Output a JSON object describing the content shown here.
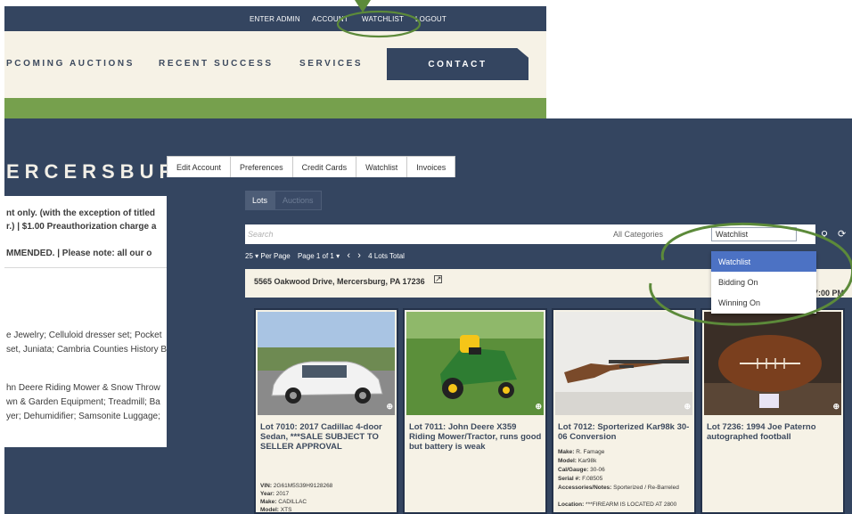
{
  "top_nav": {
    "enter_admin": "ENTER ADMIN",
    "account": "ACCOUNT",
    "watchlist": "WATCHLIST",
    "logout": "LOGOUT"
  },
  "main_nav": {
    "upcoming": "PCOMING AUCTIONS",
    "recent": "RECENT SUCCESS",
    "services": "SERVICES",
    "contact": "CONTACT"
  },
  "hero_title": "ERCERSBUR",
  "notice": {
    "line1": "nt only. (with the exception of titled",
    "line2": "r.) | $1.00 Preauthorization charge a",
    "line3": "MMENDED.  |  Please note:  all our o",
    "line4": "e Jewelry; Celluloid dresser set; Pocket",
    "line5": "set, Juniata; Cambria Counties History B",
    "line6": "hn Deere Riding Mower & Snow Throw",
    "line7": "wn & Garden Equipment; Treadmill; Ba",
    "line8": "yer; Dehumidifier; Samsonite Luggage;"
  },
  "account_tabs": [
    "Edit Account",
    "Preferences",
    "Credit Cards",
    "Watchlist",
    "Invoices"
  ],
  "toggle": {
    "lots": "Lots",
    "auctions": "Auctions"
  },
  "search": {
    "placeholder": "Search",
    "category": "All Categories",
    "filter_value": "Watchlist",
    "search_icon": "search-icon",
    "refresh_icon": "refresh-icon"
  },
  "pager": {
    "per_page": "25  ▾ Per Page",
    "page": "Page 1 of 1 ▾",
    "prev": "‹",
    "next": "›",
    "total": "4 Lots Total"
  },
  "filter_options": [
    "Watchlist",
    "Bidding On",
    "Winning On"
  ],
  "address": {
    "text": "5565 Oakwood Drive, Mercersburg, PA 17236",
    "icon": "external-link-icon",
    "time": "7:00 PM"
  },
  "cards": [
    {
      "title": "Lot 7010:  2017 Cadillac 4-door Sedan, ***SALE SUBJECT TO SELLER APPROVAL",
      "specs": [
        {
          "label": "VIN:",
          "value": " 2G61M5S39H9128268"
        },
        {
          "label": "Year:",
          "value": " 2017"
        },
        {
          "label": "Make:",
          "value": " CADILLAC"
        },
        {
          "label": "Model:",
          "value": " XTS"
        }
      ]
    },
    {
      "title": "Lot 7011:  John Deere X359 Riding Mower/Tractor, runs good but battery is weak",
      "specs": []
    },
    {
      "title": "Lot 7012:  Sporterized Kar98k 30-06 Conversion",
      "specs": [
        {
          "label": "Make:",
          "value": " R. Famage"
        },
        {
          "label": "Model:",
          "value": " Kar98k"
        },
        {
          "label": "Cal/Gauge:",
          "value": " 30-06"
        },
        {
          "label": "Serial #:",
          "value": " F.08505"
        },
        {
          "label": "Accessories/Notes:",
          "value": " Sporterized / Re-Barreled"
        },
        {
          "label": "Location:",
          "value": " ***FIREARM IS LOCATED AT 2800"
        }
      ]
    },
    {
      "title": "Lot 7236:  1994 Joe Paterno autographed football",
      "specs": []
    }
  ],
  "colors": {
    "navy": "#344560",
    "cream": "#f6f2e6",
    "green": "#76a04d",
    "highlight": "#4c72c4"
  }
}
